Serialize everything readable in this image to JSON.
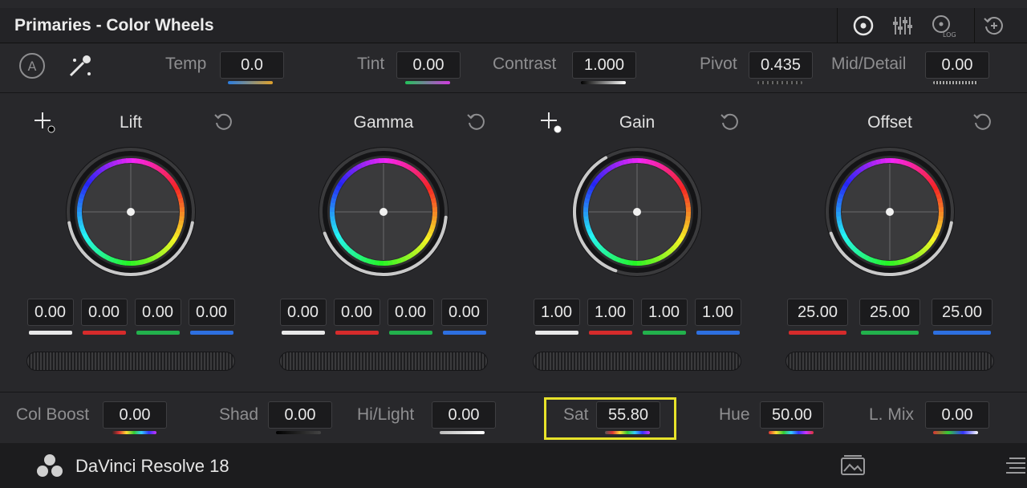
{
  "panel": {
    "title": "Primaries - Color Wheels"
  },
  "header_tools": [
    "wheels-mode-icon",
    "bars-mode-icon",
    "log-mode-icon",
    "reset-all-icon"
  ],
  "header_tool_text": {
    "log": "LOG"
  },
  "adjust": {
    "auto_label": "A",
    "temp": {
      "label": "Temp",
      "value": "0.0"
    },
    "tint": {
      "label": "Tint",
      "value": "0.00"
    },
    "contrast": {
      "label": "Contrast",
      "value": "1.000"
    },
    "pivot": {
      "label": "Pivot",
      "value": "0.435"
    },
    "mid_detail": {
      "label": "Mid/Detail",
      "value": "0.00"
    }
  },
  "wheels": [
    {
      "name": "Lift",
      "values": [
        "0.00",
        "0.00",
        "0.00",
        "0.00"
      ]
    },
    {
      "name": "Gamma",
      "values": [
        "0.00",
        "0.00",
        "0.00",
        "0.00"
      ]
    },
    {
      "name": "Gain",
      "values": [
        "1.00",
        "1.00",
        "1.00",
        "1.00"
      ]
    },
    {
      "name": "Offset",
      "values": [
        "25.00",
        "25.00",
        "25.00"
      ]
    }
  ],
  "bottom": {
    "col_boost": {
      "label": "Col Boost",
      "value": "0.00"
    },
    "shad": {
      "label": "Shad",
      "value": "0.00"
    },
    "hilight": {
      "label": "Hi/Light",
      "value": "0.00"
    },
    "sat": {
      "label": "Sat",
      "value": "55.80"
    },
    "hue": {
      "label": "Hue",
      "value": "50.00"
    },
    "lmix": {
      "label": "L. Mix",
      "value": "0.00"
    }
  },
  "status": {
    "app_name": "DaVinci Resolve 18"
  },
  "colors": {
    "highlight": "#e7e22a",
    "red": "#d62b2b",
    "green": "#22b14c",
    "blue": "#2d6fe0",
    "white": "#e8e8e8"
  }
}
